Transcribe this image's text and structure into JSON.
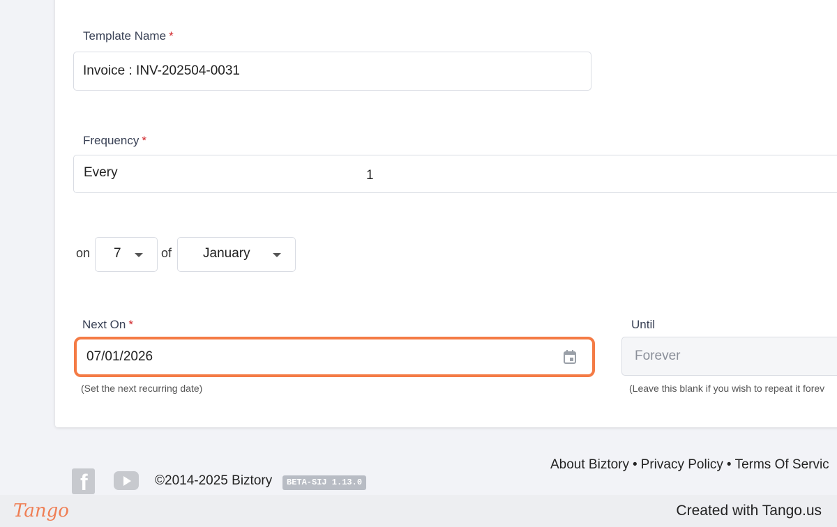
{
  "form": {
    "template_name_label": "Template Name",
    "template_name_value": "Invoice : INV-202504-0031",
    "frequency_label": "Frequency",
    "frequency_every": "Every",
    "frequency_number": "1",
    "on_label": "on",
    "day_value": "7",
    "of_label": "of",
    "month_value": "January",
    "next_on_label": "Next On",
    "next_on_value": "07/01/2026",
    "next_on_hint": "(Set the next recurring date)",
    "until_label": "Until",
    "until_placeholder": "Forever",
    "until_hint": "(Leave this blank if you wish to repeat it forev",
    "required_mark": "*"
  },
  "footer": {
    "about": "About Biztory",
    "privacy": "Privacy Policy",
    "terms": "Terms Of Servic",
    "separator": "•",
    "copyright": "©2014-2025 Biztory",
    "version_badge": "BETA-SIJ 1.13.0",
    "icons": [
      "facebook-icon",
      "youtube-icon"
    ]
  },
  "tango": {
    "logo": "Tango",
    "credit": "Created with Tango.us"
  },
  "colors": {
    "highlight": "#f47b45",
    "required": "#d0262b",
    "tango": "#ef7e54"
  }
}
